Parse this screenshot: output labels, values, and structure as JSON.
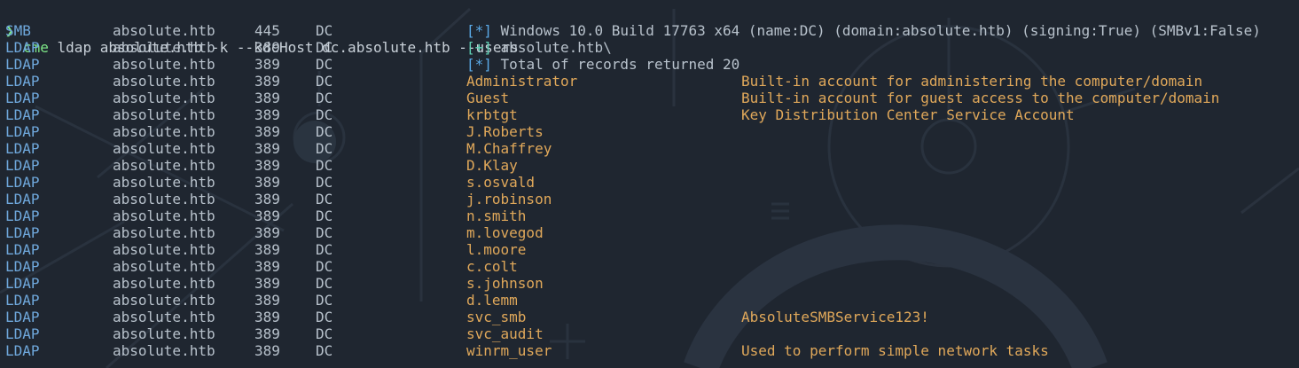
{
  "prompt": {
    "symbol": "❯",
    "command": "cme",
    "args": " ldap absolute.htb -k --kdcHost dc.absolute.htb --users"
  },
  "header_rows": [
    {
      "proto": "SMB",
      "host": "absolute.htb",
      "port": "445",
      "name": "DC",
      "tag": "[*]",
      "tag_type": "star",
      "message": "Windows 10.0 Build 17763 x64 (name:DC) (domain:absolute.htb) (signing:True) (SMBv1:False)"
    },
    {
      "proto": "LDAP",
      "host": "absolute.htb",
      "port": "389",
      "name": "DC",
      "tag": "[+]",
      "tag_type": "plus",
      "message": "absolute.htb\\"
    },
    {
      "proto": "LDAP",
      "host": "absolute.htb",
      "port": "389",
      "name": "DC",
      "tag": "[*]",
      "tag_type": "star",
      "message": "Total of records returned 20"
    }
  ],
  "user_rows": [
    {
      "proto": "LDAP",
      "host": "absolute.htb",
      "port": "389",
      "name": "DC",
      "user": "Administrator",
      "desc": "Built-in account for administering the computer/domain"
    },
    {
      "proto": "LDAP",
      "host": "absolute.htb",
      "port": "389",
      "name": "DC",
      "user": "Guest",
      "desc": "Built-in account for guest access to the computer/domain"
    },
    {
      "proto": "LDAP",
      "host": "absolute.htb",
      "port": "389",
      "name": "DC",
      "user": "krbtgt",
      "desc": "Key Distribution Center Service Account"
    },
    {
      "proto": "LDAP",
      "host": "absolute.htb",
      "port": "389",
      "name": "DC",
      "user": "J.Roberts",
      "desc": ""
    },
    {
      "proto": "LDAP",
      "host": "absolute.htb",
      "port": "389",
      "name": "DC",
      "user": "M.Chaffrey",
      "desc": ""
    },
    {
      "proto": "LDAP",
      "host": "absolute.htb",
      "port": "389",
      "name": "DC",
      "user": "D.Klay",
      "desc": ""
    },
    {
      "proto": "LDAP",
      "host": "absolute.htb",
      "port": "389",
      "name": "DC",
      "user": "s.osvald",
      "desc": ""
    },
    {
      "proto": "LDAP",
      "host": "absolute.htb",
      "port": "389",
      "name": "DC",
      "user": "j.robinson",
      "desc": ""
    },
    {
      "proto": "LDAP",
      "host": "absolute.htb",
      "port": "389",
      "name": "DC",
      "user": "n.smith",
      "desc": ""
    },
    {
      "proto": "LDAP",
      "host": "absolute.htb",
      "port": "389",
      "name": "DC",
      "user": "m.lovegod",
      "desc": ""
    },
    {
      "proto": "LDAP",
      "host": "absolute.htb",
      "port": "389",
      "name": "DC",
      "user": "l.moore",
      "desc": ""
    },
    {
      "proto": "LDAP",
      "host": "absolute.htb",
      "port": "389",
      "name": "DC",
      "user": "c.colt",
      "desc": ""
    },
    {
      "proto": "LDAP",
      "host": "absolute.htb",
      "port": "389",
      "name": "DC",
      "user": "s.johnson",
      "desc": ""
    },
    {
      "proto": "LDAP",
      "host": "absolute.htb",
      "port": "389",
      "name": "DC",
      "user": "d.lemm",
      "desc": ""
    },
    {
      "proto": "LDAP",
      "host": "absolute.htb",
      "port": "389",
      "name": "DC",
      "user": "svc_smb",
      "desc": "AbsoluteSMBService123!"
    },
    {
      "proto": "LDAP",
      "host": "absolute.htb",
      "port": "389",
      "name": "DC",
      "user": "svc_audit",
      "desc": ""
    },
    {
      "proto": "LDAP",
      "host": "absolute.htb",
      "port": "389",
      "name": "DC",
      "user": "winrm_user",
      "desc": "Used to perform simple network tasks"
    }
  ],
  "colors": {
    "background": "#1f2630",
    "prompt": "#7ee787",
    "protocol": "#6fa8dc",
    "text": "#b8c2cc",
    "username": "#e0a85a",
    "tag_star": "#5aa9e6",
    "tag_plus": "#5fd0b4"
  }
}
